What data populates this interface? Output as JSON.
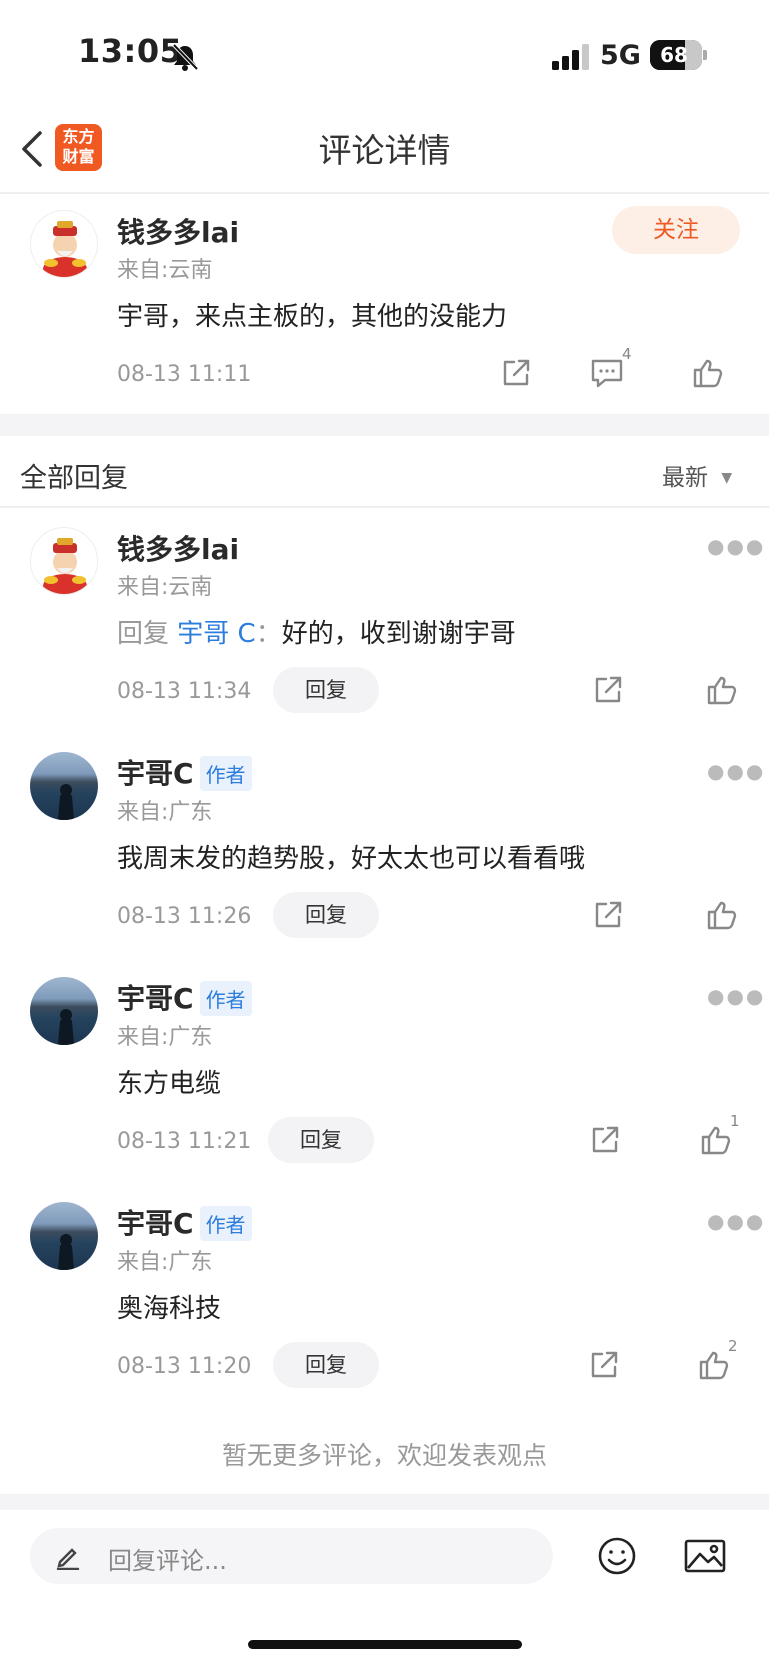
{
  "status_bar": {
    "time": "13:05",
    "network": "5G",
    "battery": "68",
    "battery_level": 0.68
  },
  "nav": {
    "title": "评论详情",
    "logo_text": "东方财富",
    "logo_line1": "东方",
    "logo_line2": "财富"
  },
  "main_comment": {
    "name": "钱多多lai",
    "from": "来自:云南",
    "text": "宇哥，来点主板的，其他的没能力",
    "time": "08-13 11:11",
    "follow_label": "关注",
    "reply_count": "4"
  },
  "replies_header": {
    "title": "全部回复",
    "sort_label": "最新"
  },
  "replies": [
    {
      "name": "钱多多lai",
      "from": "来自:云南",
      "reply_prefix": "回复",
      "reply_target": "宇哥 C",
      "reply_sep": "：",
      "text": "好的，收到谢谢宇哥",
      "time": "08-13 11:34",
      "reply_label": "回复",
      "likes": ""
    },
    {
      "name": "宇哥C",
      "tag": "作者",
      "from": "来自:广东",
      "text": "我周末发的趋势股，好太太也可以看看哦",
      "time": "08-13 11:26",
      "reply_label": "回复",
      "likes": ""
    },
    {
      "name": "宇哥C",
      "tag": "作者",
      "from": "来自:广东",
      "text": "东方电缆",
      "time": "08-13 11:21",
      "reply_label": "回复",
      "likes": "1"
    },
    {
      "name": "宇哥C",
      "tag": "作者",
      "from": "来自:广东",
      "text": "奥海科技",
      "time": "08-13 11:20",
      "reply_label": "回复",
      "likes": "2"
    }
  ],
  "footer_note": "暂无更多评论，欢迎发表观点",
  "bottom_bar": {
    "input_placeholder": "回复评论..."
  },
  "colors": {
    "accent": "#ee5a24",
    "link": "#2d7ddc",
    "logo_bg": "#f05a22"
  },
  "icons": [
    "bell-off-icon",
    "signal-icon",
    "battery-icon",
    "back-icon",
    "share-icon",
    "comment-icon",
    "like-icon",
    "more-icon",
    "sort-caret-icon",
    "pencil-icon",
    "emoji-icon",
    "image-icon"
  ]
}
